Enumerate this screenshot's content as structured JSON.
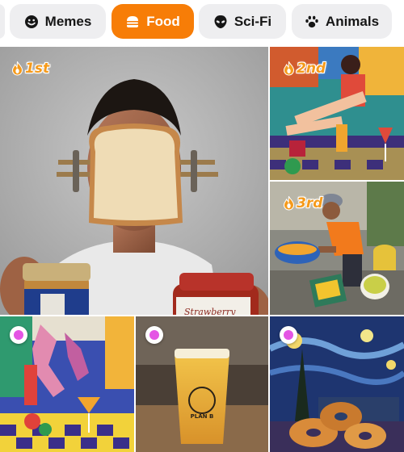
{
  "categories": [
    {
      "label": "Memes",
      "icon": "smiley-face-icon",
      "active": false
    },
    {
      "label": "Food",
      "icon": "burger-icon",
      "active": true
    },
    {
      "label": "Sci-Fi",
      "icon": "alien-head-icon",
      "active": false
    },
    {
      "label": "Animals",
      "icon": "paw-print-icon",
      "active": false
    }
  ],
  "colors": {
    "accent": "#f77d07",
    "chip_bg": "#eeeef0",
    "rank": "#f59a1b",
    "marker": "#e455e4"
  },
  "tiles": [
    {
      "rank": "1st",
      "subject": "man with bread slice clipped to face holding peanut butter and jam jars",
      "jar_label": "Strawberry Jam"
    },
    {
      "rank": "2nd",
      "subject": "pixel art woman with drink"
    },
    {
      "rank": "3rd",
      "subject": "street vendor peeling mangoes"
    },
    {
      "subject": "pixel art figure with cocktail"
    },
    {
      "subject": "glass of beer",
      "glass_text": "PLAN B"
    },
    {
      "subject": "starry night style painting with bagels"
    }
  ]
}
